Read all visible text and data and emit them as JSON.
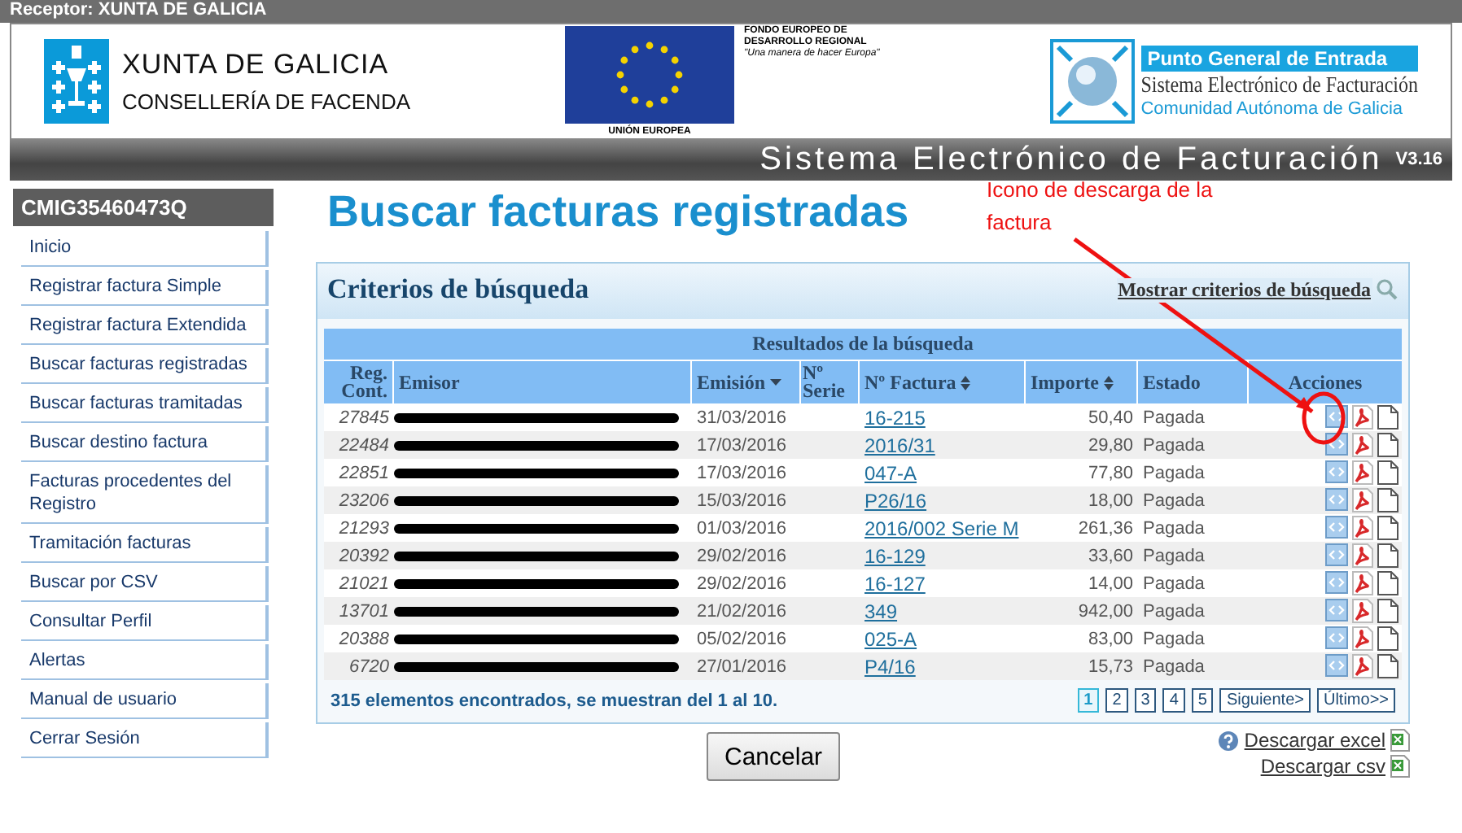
{
  "top_bar": {
    "title": "Receptor: XUNTA DE GALICIA"
  },
  "header": {
    "xunta_name": "XUNTA DE GALICIA",
    "xunta_dept": "CONSELLERÍA DE FACENDA",
    "eu_fund": "FONDO EUROPEO DE DESARROLLO REGIONAL",
    "eu_motto": "\"Una manera de hacer Europa\"",
    "eu_label": "UNIÓN EUROPEA",
    "pge_badge": "Punto General de Entrada",
    "pge_title": "Sistema Electrónico de Facturación",
    "pge_sub": "Comunidad Autónoma de Galicia"
  },
  "banner": {
    "title": "Sistema Electrónico de Facturación",
    "version": "V3.16"
  },
  "sidebar": {
    "user": "CMIG35460473Q",
    "items": [
      {
        "label": "Inicio",
        "selected": false
      },
      {
        "label": "Registrar factura Simple",
        "selected": false
      },
      {
        "label": "Registrar factura Extendida",
        "selected": false
      },
      {
        "label": "Buscar facturas registradas",
        "selected": false
      },
      {
        "label": "Buscar facturas tramitadas",
        "selected": false
      },
      {
        "label": "Buscar destino factura",
        "selected": false
      },
      {
        "label": "Facturas procedentes del Registro",
        "selected": false
      },
      {
        "label": "Tramitación facturas",
        "selected": false
      },
      {
        "label": "Buscar por CSV",
        "selected": false
      },
      {
        "label": "Consultar Perfil",
        "selected": false
      },
      {
        "label": "Alertas",
        "selected": false
      },
      {
        "label": "Manual de usuario",
        "selected": false
      },
      {
        "label": "Cerrar Sesión",
        "selected": false
      }
    ]
  },
  "page_title": "Buscar facturas registradas",
  "annotation": "Icono de descarga de la factura",
  "panel": {
    "title": "Criterios de búsqueda",
    "toggle_link": "Mostrar criterios de búsqueda",
    "results_title": "Resultados de la búsqueda",
    "columns": [
      {
        "label": "Reg. Cont.",
        "sortable": false,
        "sorted": false
      },
      {
        "label": "Emisor",
        "sortable": false,
        "sorted": false
      },
      {
        "label": "Emisión",
        "sortable": true,
        "sorted": true
      },
      {
        "label": "Nº Serie",
        "sortable": false,
        "sorted": false
      },
      {
        "label": "Nº Factura",
        "sortable": true,
        "sorted": false
      },
      {
        "label": "Importe",
        "sortable": true,
        "sorted": false
      },
      {
        "label": "Estado",
        "sortable": false,
        "sorted": false
      },
      {
        "label": "Acciones",
        "sortable": false,
        "sorted": false
      }
    ],
    "rows": [
      {
        "reg": "27845",
        "date": "31/03/2016",
        "invoice": "16-215",
        "amount": "50,40",
        "status": "Pagada"
      },
      {
        "reg": "22484",
        "date": "17/03/2016",
        "invoice": "2016/31",
        "amount": "29,80",
        "status": "Pagada"
      },
      {
        "reg": "22851",
        "date": "17/03/2016",
        "invoice": "047-A",
        "amount": "77,80",
        "status": "Pagada"
      },
      {
        "reg": "23206",
        "date": "15/03/2016",
        "invoice": "P26/16",
        "amount": "18,00",
        "status": "Pagada"
      },
      {
        "reg": "21293",
        "date": "01/03/2016",
        "invoice": "2016/002 Serie M",
        "amount": "261,36",
        "status": "Pagada"
      },
      {
        "reg": "20392",
        "date": "29/02/2016",
        "invoice": "16-129",
        "amount": "33,60",
        "status": "Pagada"
      },
      {
        "reg": "21021",
        "date": "29/02/2016",
        "invoice": "16-127",
        "amount": "14,00",
        "status": "Pagada"
      },
      {
        "reg": "13701",
        "date": "21/02/2016",
        "invoice": "349",
        "amount": "942,00",
        "status": "Pagada"
      },
      {
        "reg": "20388",
        "date": "05/02/2016",
        "invoice": "025-A",
        "amount": "83,00",
        "status": "Pagada"
      },
      {
        "reg": "6720",
        "date": "27/01/2016",
        "invoice": "P4/16",
        "amount": "15,73",
        "status": "Pagada"
      }
    ],
    "summary": "315 elementos encontrados, se muestran del 1 al 10.",
    "pages": [
      {
        "label": "1",
        "selected": true
      },
      {
        "label": "2",
        "selected": false
      },
      {
        "label": "3",
        "selected": false
      },
      {
        "label": "4",
        "selected": false
      },
      {
        "label": "5",
        "selected": false
      }
    ],
    "next": "Siguiente>",
    "last": "Último>>"
  },
  "cancel_button": "Cancelar",
  "downloads": [
    "Descargar excel",
    "Descargar csv"
  ]
}
